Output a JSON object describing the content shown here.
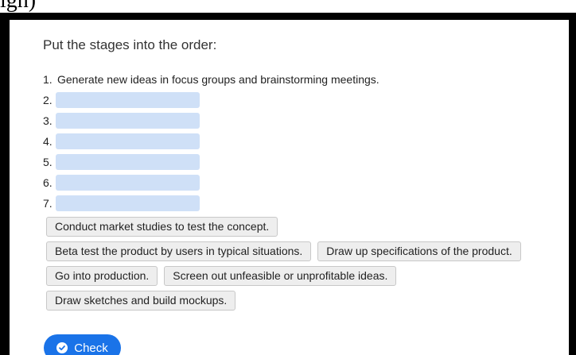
{
  "caption": "igh)",
  "question": "Put the stages into the order:",
  "stages": [
    {
      "number": "1.",
      "text": "Generate new ideas in focus groups and brainstorming meetings."
    },
    {
      "number": "2."
    },
    {
      "number": "3."
    },
    {
      "number": "4."
    },
    {
      "number": "5."
    },
    {
      "number": "6."
    },
    {
      "number": "7."
    }
  ],
  "options": [
    [
      "Conduct market studies to test the concept."
    ],
    [
      "Beta test the product by users in typical situations.",
      "Draw up specifications of the product."
    ],
    [
      "Go into production.",
      "Screen out unfeasible or unprofitable ideas."
    ],
    [
      "Draw sketches and build mockups."
    ]
  ],
  "check_button": {
    "label": "Check",
    "icon": "check-circle-icon"
  },
  "colors": {
    "slot": "#cfe0f7",
    "button": "#1a73e8",
    "chip": "#eeeeee"
  }
}
